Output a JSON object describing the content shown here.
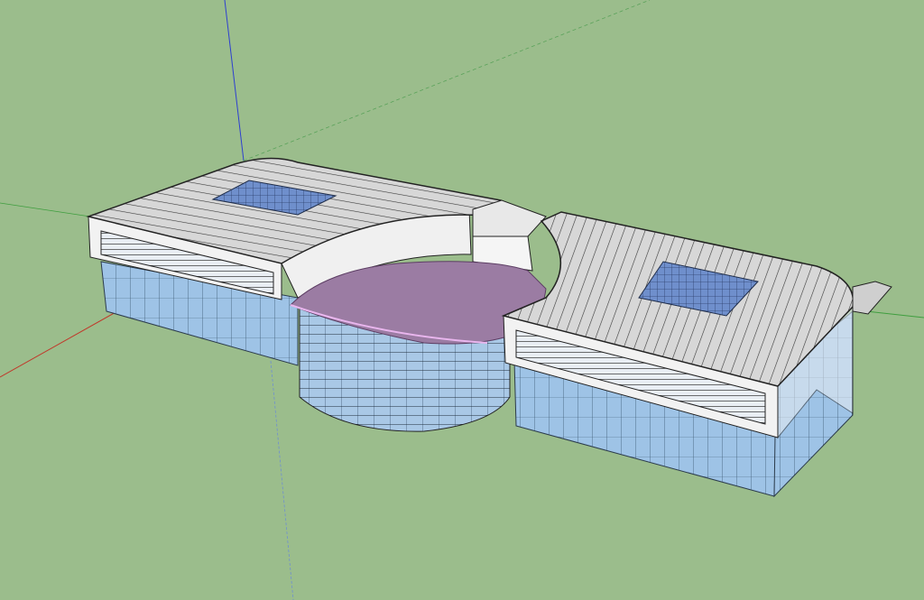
{
  "app": {
    "view": "3d-model-viewport",
    "background_color": "#9bbd8c",
    "axes": {
      "red_axis_color": "#c0392b",
      "green_axis_color": "#3f9e3f",
      "blue_axis_color": "#2d3fd0"
    }
  },
  "model": {
    "description_icons": [
      "building-model"
    ],
    "roof_color": "#cfcfcf",
    "roof_line_color": "#2a2a2a",
    "glass_color": "#8fb8e0",
    "plaza_color": "#9b7ca3",
    "wall_color": "#eeeeee",
    "skylight_color": "#5d7fbf"
  }
}
